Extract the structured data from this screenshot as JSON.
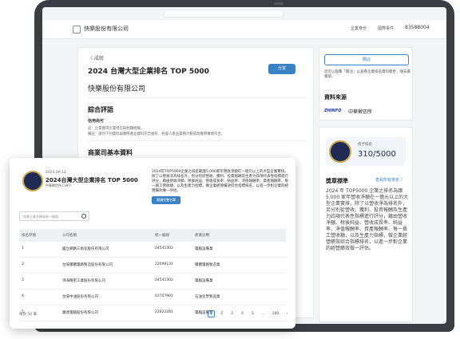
{
  "header": {
    "company": "快樂股份有限公司",
    "link1": "企業身份",
    "link2": "國際事件",
    "account": "83588004"
  },
  "main": {
    "back": "〈 成就",
    "title": "2024 台灣大型企業排名 TOP 5000",
    "share": "分享",
    "company_name": "快樂股份有限公司",
    "sec_review": "綜合評語",
    "credit_label": "信用尚可",
    "credit_line1": "註：企業獲得企業授信與相關經驗。",
    "credit_line2": "備註：請勿下列資料與實際產品資料完全相符，各會人產品業務計劃或政實際實情符合。",
    "sec_basic": "商業司基本資料"
  },
  "side": {
    "favorite": "關註",
    "note": "您可以點擊「關注」以查看企業排名資料變更，隨去最獲取。",
    "source_title": "資料來源",
    "source_logo": "ZHINFO",
    "source_name": "中華徵信所",
    "score_label": "授予排名",
    "score_value": "310/5000",
    "view_title": "獎章標準",
    "view_link": "查看所有排名 〉",
    "view_desc": "2024 年 TOP5000 企業之排名為跟 5,000 家年營收淨額在一億元以上的大型企業實排，除了以營收淨為排名外，另分別從營收、獲利、投資報酬及生產力四項代表性指標進行評分，藉由營收淨額、稅後純益、營收成長率、純益率、淨值報酬率、資產報酬率、每一員工營收額，以及生產力指標，做企業經營績效綜合指標排名，以進一步對企業的經營績效做一評估。"
  },
  "popup": {
    "date": "2024.09.12",
    "title": "2024台灣大型企業排名 TOP 5000",
    "subtitle": "中華徵信所 CHFP",
    "desc": "2024年TOP5000企業之排名範圍5,000家年營收淨額在一億元以上的大型企業實排，除了以營收淨為排名外，另分別從營收、獲利、投資報酬及生產力四項代表性指標進行評分，藉由營收淨額、稅後純益、營收成長率、純益率、淨值報酬率、資產報酬率、每一員工營收額，以及生產力指標，做企業經營績效綜合指標排名，以進一步對企業的經營績效做一評估。",
    "button": "閱讀完整名單",
    "search_placeholder": "搜尋企業名稱或統一編號",
    "columns": [
      "排名序號",
      "公司名稱",
      "統一編號",
      "產業分類"
    ],
    "rows": [
      [
        "1",
        "國立網路三角化股份有限公司",
        "04541302",
        "電腦設備業"
      ],
      [
        "2",
        "台灣積體電路製造股份有限公司",
        "22099131",
        "積體電路製造業"
      ],
      [
        "3",
        "鴻海精密工業股份有限公司",
        "04541302",
        "電腦設備業"
      ],
      [
        "4",
        "台灣中油股份有限公司",
        "03707901",
        "石油化學製品業"
      ],
      [
        "5",
        "廣達電腦股份有限公司",
        "22822281",
        "電腦設備業"
      ]
    ],
    "footer": "每頁 50 筆",
    "pager": [
      "‹",
      "1",
      "2",
      "3",
      "4",
      "5",
      "…",
      "100",
      "›"
    ]
  }
}
